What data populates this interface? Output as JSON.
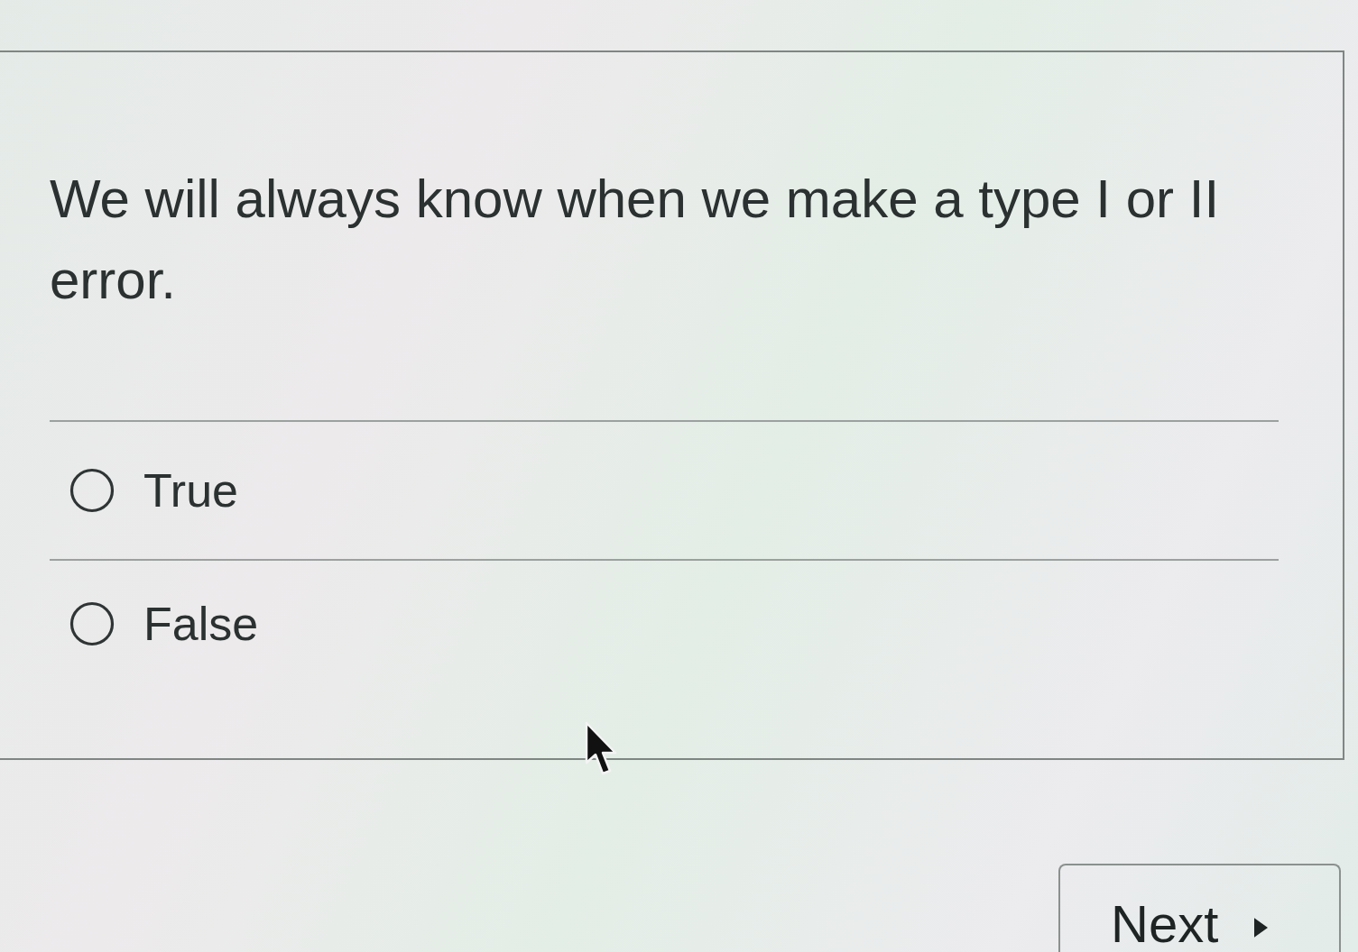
{
  "question": {
    "text": "We will always know when we make a type I or II error."
  },
  "options": [
    {
      "label": "True",
      "selected": false
    },
    {
      "label": "False",
      "selected": false
    }
  ],
  "next_button": {
    "label": "Next"
  }
}
